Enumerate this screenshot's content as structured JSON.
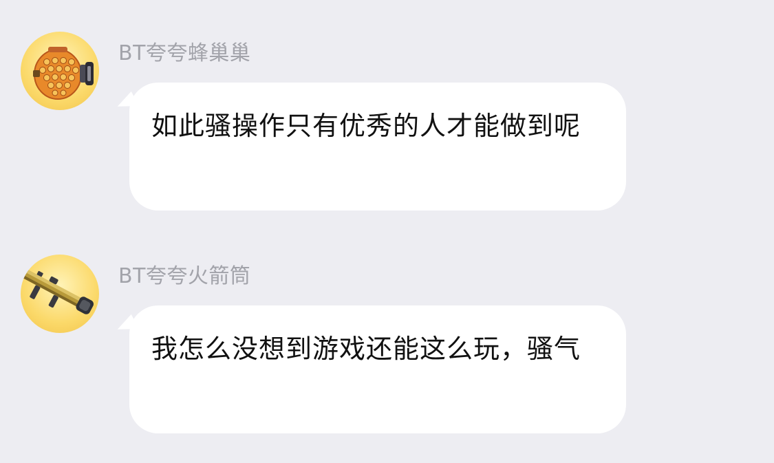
{
  "messages": [
    {
      "sender": "BT夸夸蜂巢巢",
      "avatar_icon": "honeycomb-grenade-icon",
      "text": "如此骚操作只有优秀的人才能做到呢"
    },
    {
      "sender": "BT夸夸火箭筒",
      "avatar_icon": "rocket-launcher-icon",
      "text": "我怎么没想到游戏还能这么玩，骚气"
    }
  ],
  "colors": {
    "background": "#EDEDF2",
    "bubble": "#FFFFFF",
    "sender_name": "#A2A3AA",
    "message_text": "#111111",
    "avatar_bg": "#FBD96A"
  }
}
